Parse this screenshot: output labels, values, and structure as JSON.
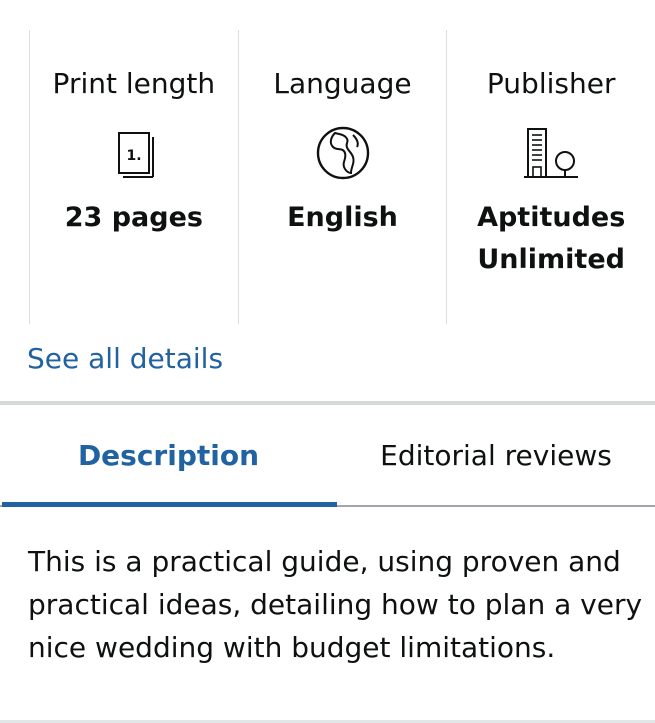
{
  "details": [
    {
      "label": "Print length",
      "icon": "page-count-icon",
      "value": "23 pages"
    },
    {
      "label": "Language",
      "icon": "globe-icon",
      "value": "English"
    },
    {
      "label": "Publisher",
      "icon": "publisher-building-icon",
      "value": "Aptitudes\nUnlimited"
    }
  ],
  "page_icon_text": "1.",
  "see_all_link": "See all details",
  "tabs": [
    {
      "label": "Description",
      "active": true
    },
    {
      "label": "Editorial reviews",
      "active": false
    }
  ],
  "description": "This is a practical guide, using proven and practical ideas, detailing how to plan a very nice wedding with budget limitations.",
  "colors": {
    "link": "#2162a1",
    "text": "#0f1111",
    "divider": "#dddddd"
  }
}
